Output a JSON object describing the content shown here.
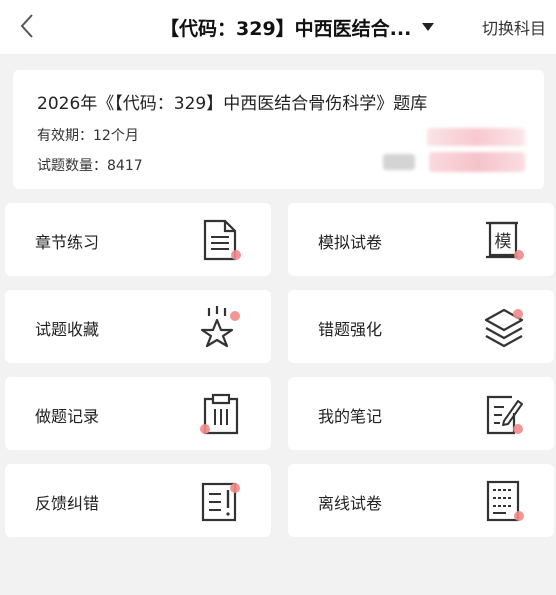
{
  "header": {
    "title": "【代码：329】中西医结合...",
    "switch_label": "切换科目"
  },
  "bank": {
    "title": "2026年《【代码：329】中西医结合骨伤科学》题库",
    "validity": "有效期：12个月",
    "count": "试题数量：8417"
  },
  "features": [
    {
      "label": "章节练习",
      "icon": "document-icon"
    },
    {
      "label": "模拟试卷",
      "icon": "scroll-exam-icon",
      "glyph": "模"
    },
    {
      "label": "试题收藏",
      "icon": "star-icon"
    },
    {
      "label": "错题强化",
      "icon": "layers-icon"
    },
    {
      "label": "做题记录",
      "icon": "clipboard-icon"
    },
    {
      "label": "我的笔记",
      "icon": "note-pen-icon"
    },
    {
      "label": "反馈纠错",
      "icon": "feedback-icon"
    },
    {
      "label": "离线试卷",
      "icon": "offline-paper-icon"
    }
  ],
  "colors": {
    "accent_dot": "#f08a8a",
    "icon_stroke": "#333333"
  }
}
